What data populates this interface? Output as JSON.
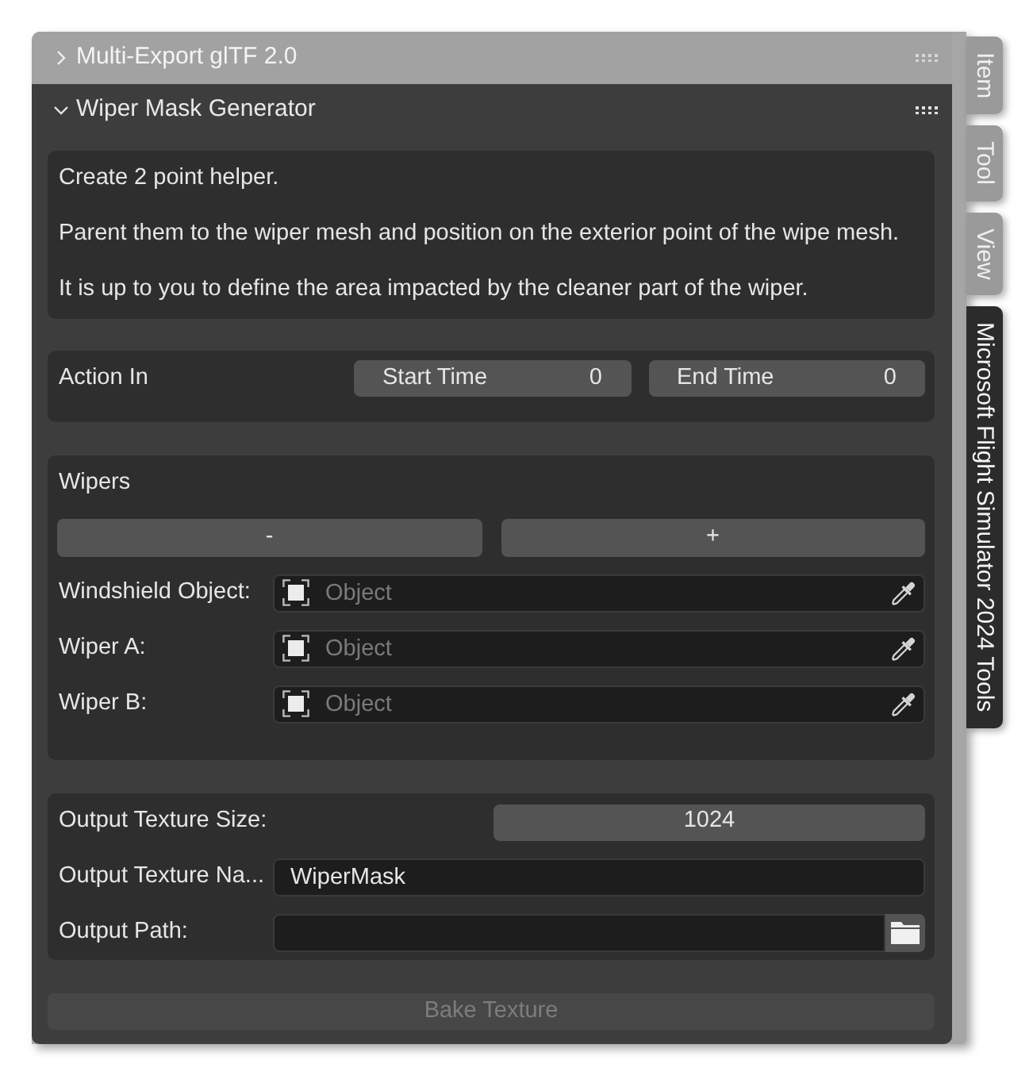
{
  "panels": [
    {
      "title": "Multi-Export glTF 2.0",
      "expanded": false
    },
    {
      "title": "Wiper Mask Generator",
      "expanded": true
    }
  ],
  "description": [
    "Create 2 point helper.",
    "Parent them to the wiper mesh and position on the exterior point of the wipe mesh.",
    "It is up to you to define the area impacted by the cleaner part of the wiper."
  ],
  "action_in": {
    "label": "Action In",
    "fields": [
      {
        "label": "Start Time",
        "value": "0"
      },
      {
        "label": "End Time",
        "value": "0"
      }
    ]
  },
  "wipers": {
    "title": "Wipers",
    "buttons": [
      "-",
      "+"
    ],
    "objects": [
      {
        "label": "Windshield Object:",
        "placeholder": "Object"
      },
      {
        "label": "Wiper A:",
        "placeholder": "Object"
      },
      {
        "label": "Wiper B:",
        "placeholder": "Object"
      }
    ]
  },
  "output": {
    "texture_size": {
      "label": "Output Texture Size:",
      "value": "1024"
    },
    "texture_name": {
      "label": "Output Texture Na...",
      "value": "WiperMask"
    },
    "path": {
      "label": "Output Path:"
    }
  },
  "bake_button": {
    "label": "Bake Texture",
    "disabled": true
  },
  "tabs": [
    {
      "label": "Item",
      "selected": false
    },
    {
      "label": "Tool",
      "selected": false
    },
    {
      "label": "View",
      "selected": false
    },
    {
      "label": "Microsoft Flight Simulator 2024 Tools",
      "selected": true
    }
  ]
}
